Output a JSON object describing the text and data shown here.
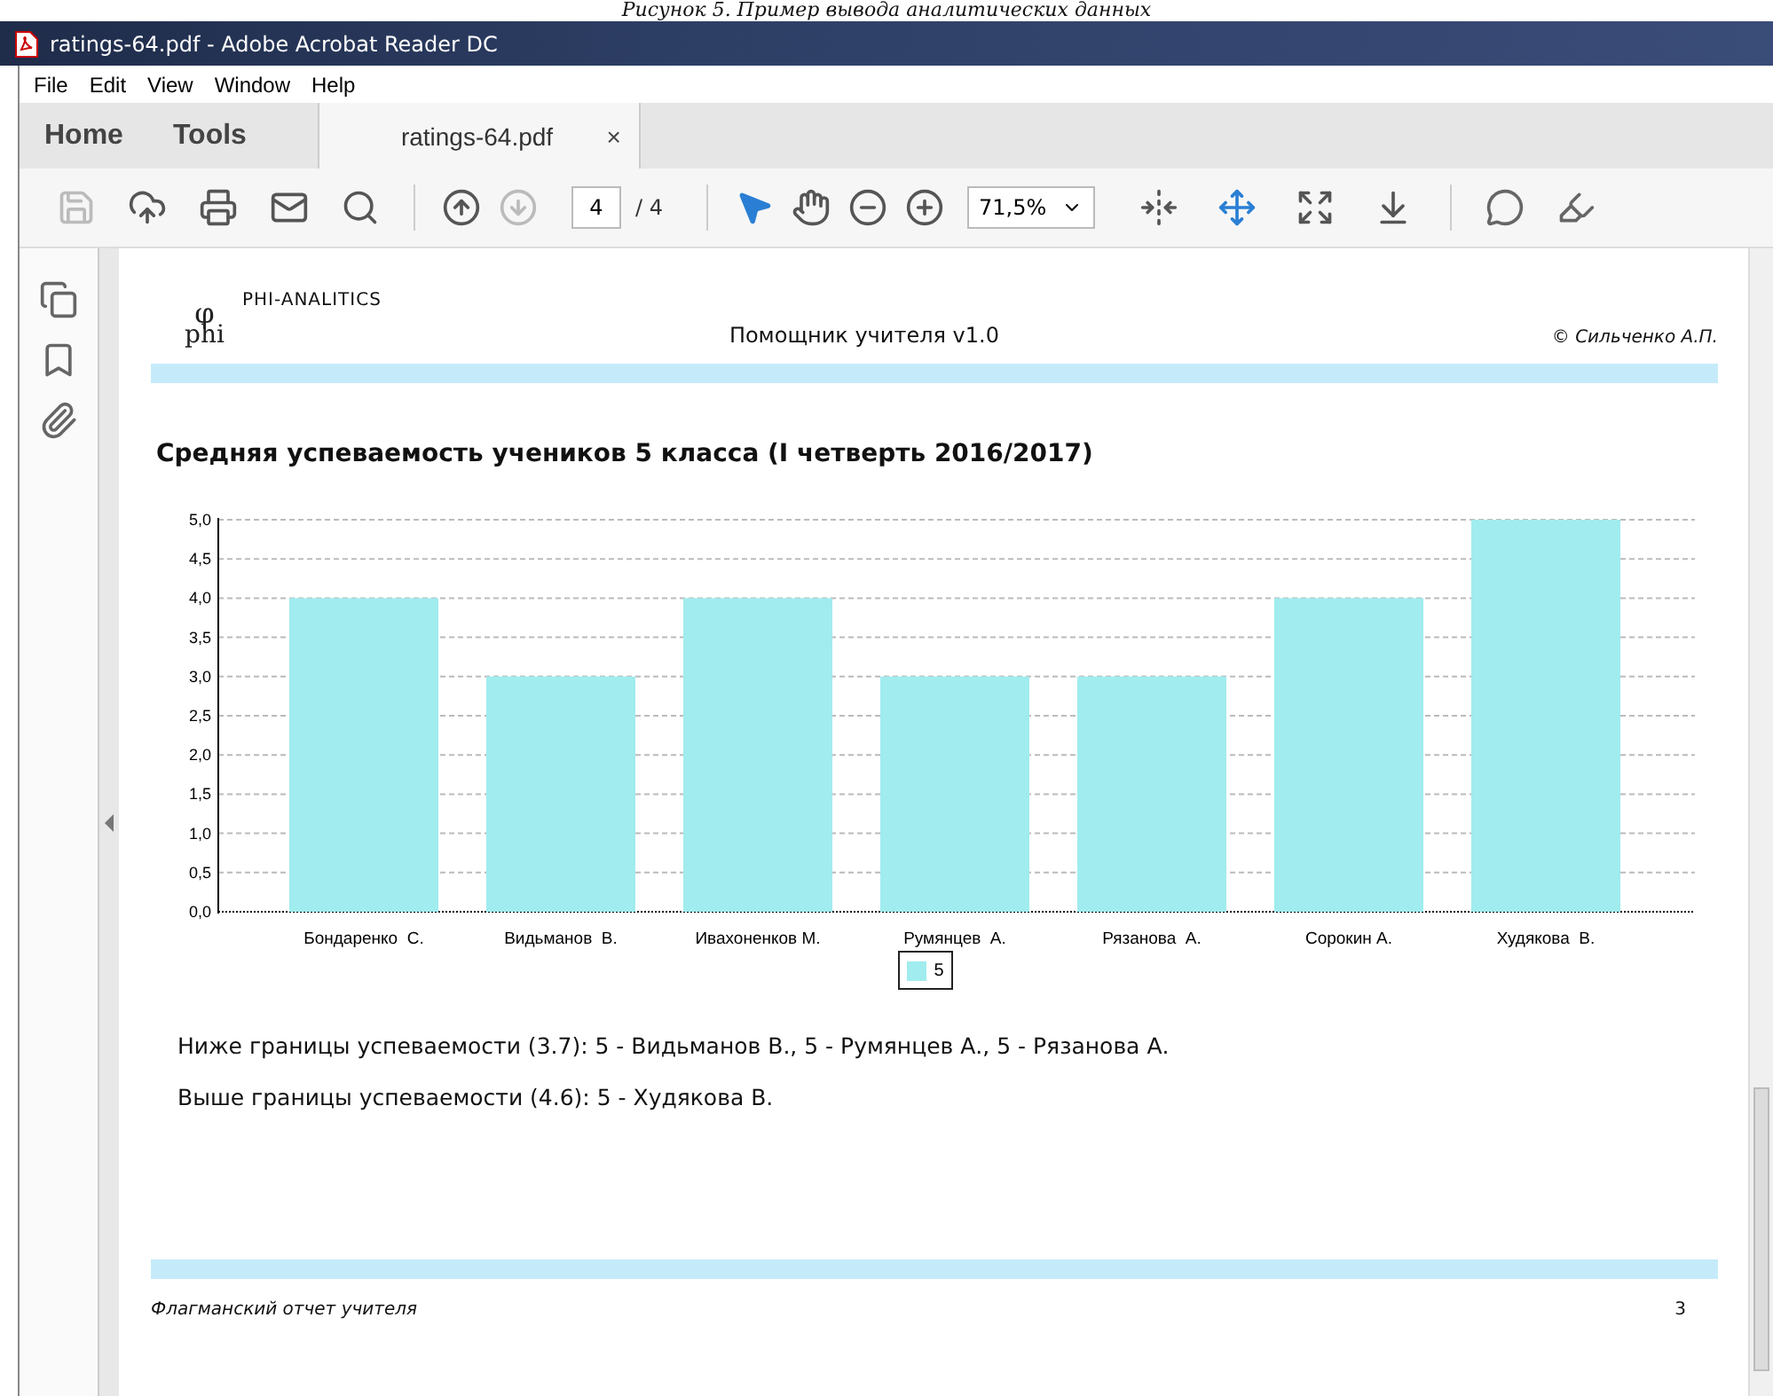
{
  "caption": "Рисунок 5. Пример вывода аналитических данных",
  "window": {
    "title": "ratings-64.pdf - Adobe Acrobat Reader DC"
  },
  "menu": [
    "File",
    "Edit",
    "View",
    "Window",
    "Help"
  ],
  "tabs": [
    {
      "label": "Home",
      "selected": false,
      "kind": "nav"
    },
    {
      "label": "Tools",
      "selected": false,
      "kind": "nav"
    },
    {
      "label": "ratings-64.pdf",
      "selected": true,
      "kind": "document",
      "close": "×"
    }
  ],
  "toolbar": {
    "left": [
      {
        "kind": "save",
        "disabled": true
      },
      {
        "kind": "upload",
        "disabled": false
      },
      {
        "kind": "print",
        "disabled": false
      },
      {
        "kind": "mail",
        "disabled": false
      },
      {
        "kind": "search",
        "disabled": false
      }
    ],
    "nav": [
      {
        "kind": "up",
        "disabled": false
      },
      {
        "kind": "down",
        "disabled": true
      }
    ],
    "page": {
      "value": "4",
      "total": "/ 4"
    },
    "tools": [
      {
        "kind": "select",
        "selected": true
      },
      {
        "kind": "hand",
        "selected": false
      },
      {
        "kind": "zoom-out",
        "selected": false
      },
      {
        "kind": "zoom-in",
        "selected": false
      }
    ],
    "zoom": {
      "value": "71,5%"
    },
    "view": [
      {
        "kind": "fit-width"
      },
      {
        "kind": "fit-page"
      },
      {
        "kind": "fullscreen"
      },
      {
        "kind": "scroll"
      }
    ],
    "annotate": [
      {
        "kind": "comment"
      },
      {
        "kind": "highlight"
      }
    ]
  },
  "sidebar": {
    "items": [
      {
        "kind": "pages"
      },
      {
        "kind": "bookmarks"
      },
      {
        "kind": "attachments"
      }
    ],
    "expanded": false
  },
  "document": {
    "logo": {
      "symbol": "φ",
      "letters": "phi"
    },
    "brand": "PHI-ANALITICS",
    "app_name": "Помощник учителя v1.0",
    "author": "© Сильченко А.П.",
    "chart": {
      "chart_data": {
        "type": "bar",
        "title": "Средняя успеваемость учеников 5 класса (I четверть 2016/2017)",
        "categories": [
          "Бондаренко  С.",
          "Видьманов  В.",
          "Ивахоненков М.",
          "Румянцев  А.",
          "Рязанова  А.",
          "Сорокин А.",
          "Худякова  В."
        ],
        "series": [
          {
            "name": "5",
            "color": "#a0ecee",
            "values": [
              4,
              3,
              4,
              3,
              3,
              4,
              5
            ]
          }
        ],
        "ylim": [
          0,
          5
        ],
        "grid": true,
        "yticks": [
          {
            "value": 0,
            "label": "0,0"
          },
          {
            "value": 0.5,
            "label": "0,5"
          },
          {
            "value": 1,
            "label": "1,0"
          },
          {
            "value": 1.5,
            "label": "1,5"
          },
          {
            "value": 2,
            "label": "2,0"
          },
          {
            "value": 2.5,
            "label": "2,5"
          },
          {
            "value": 3,
            "label": "3,0"
          },
          {
            "value": 3.5,
            "label": "3,5"
          },
          {
            "value": 4,
            "label": "4,0"
          },
          {
            "value": 4.5,
            "label": "4,5"
          },
          {
            "value": 5,
            "label": "5,0"
          }
        ]
      }
    },
    "notes": [
      "Ниже границы успеваемости (3.7): 5 - Видьманов  В., 5 - Румянцев  А., 5 - Рязанова  А.",
      "Выше границы успеваемости (4.6): 5 - Худякова  В."
    ],
    "footer": {
      "title": "Флагманский отчет учителя",
      "page_number": "3"
    }
  }
}
